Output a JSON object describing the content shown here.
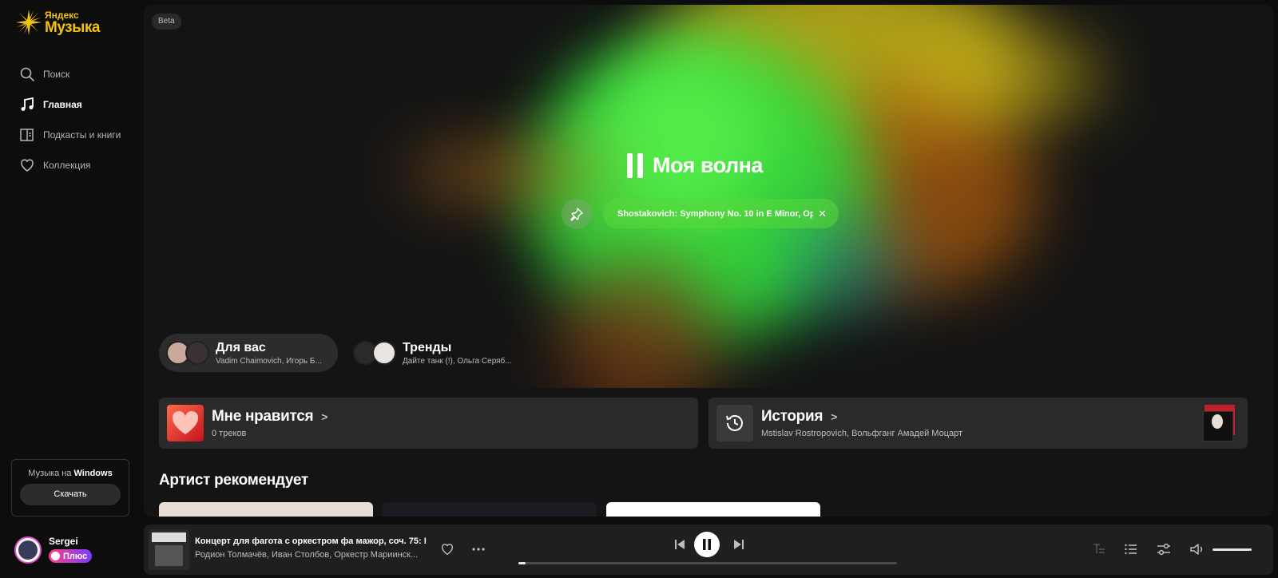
{
  "app": {
    "logo_small": "Яндекс",
    "logo_big": "Музыка"
  },
  "sidebar": {
    "items": [
      {
        "label": "Поиск",
        "icon": "search-icon"
      },
      {
        "label": "Главная",
        "icon": "music-note-icon",
        "active": true
      },
      {
        "label": "Подкасты и книги",
        "icon": "book-icon"
      },
      {
        "label": "Коллекция",
        "icon": "heart-icon"
      }
    ],
    "promo": {
      "text_prefix": "Музыка на",
      "text_platform": "Windows",
      "button": "Скачать"
    },
    "user": {
      "name": "Sergei",
      "badge": "Плюс"
    }
  },
  "wave": {
    "badge": "Beta",
    "title": "Моя волна",
    "now_playing": "Shostakovich: Symphony No. 10 in E Minor, Op...",
    "mixes": [
      {
        "title": "Для вас",
        "subtitle": "Vadim Chaimovich, Игорь Б..."
      },
      {
        "title": "Тренды",
        "subtitle": "Дайте танк (!), Ольга Серяб..."
      }
    ]
  },
  "cards": {
    "liked": {
      "title": "Мне нравится",
      "subtitle": "0 треков"
    },
    "history": {
      "title": "История",
      "subtitle": "Mstislav Rostropovich, Вольфганг Амадей Моцарт"
    }
  },
  "section": {
    "title": "Артист рекомендует"
  },
  "player": {
    "title": "Концерт для фагота с оркестром фа мажор, соч. 75: I...",
    "artists": "Родион Толмачёв, Иван Столбов, Оркестр Мариинск...",
    "progress": 0.02,
    "volume": 1.0
  },
  "colors": {
    "accent_yellow": "#f0c30f",
    "wave_green": "#3ddc3a",
    "plus_gradient_start": "#ff3f86",
    "plus_gradient_end": "#7a3cff"
  }
}
